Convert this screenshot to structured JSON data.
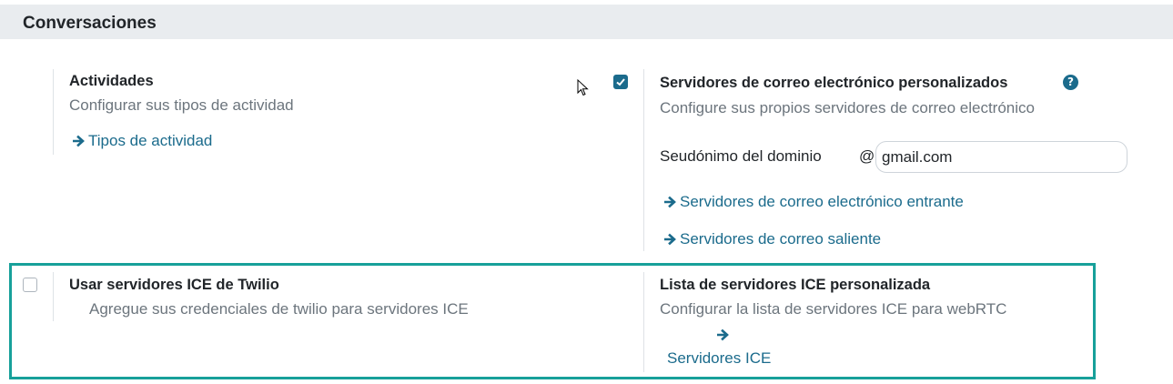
{
  "section": {
    "title": "Conversaciones"
  },
  "activities": {
    "title": "Actividades",
    "description": "Configurar sus tipos de actividad",
    "link": "Tipos de actividad"
  },
  "custom_mail": {
    "checked": true,
    "title": "Servidores de correo electrónico personalizados",
    "help": "?",
    "description": "Configure sus propios servidores de correo electrónico",
    "alias_label": "Seudónimo del dominio",
    "at": "@",
    "alias_value": "gmail.com",
    "incoming_link": "Servidores de correo electrónico entrante",
    "outgoing_link": "Servidores de correo saliente"
  },
  "twilio": {
    "checked": false,
    "title": "Usar servidores ICE de Twilio",
    "description": "Agregue sus credenciales de twilio para servidores ICE"
  },
  "ice_list": {
    "title": "Lista de servidores ICE personalizada",
    "description": "Configurar la lista de servidores ICE para webRTC",
    "link": "Servidores ICE"
  },
  "colors": {
    "accent": "#1b6b8c",
    "highlight": "#17a09a",
    "header_bg": "#e9ecef"
  }
}
